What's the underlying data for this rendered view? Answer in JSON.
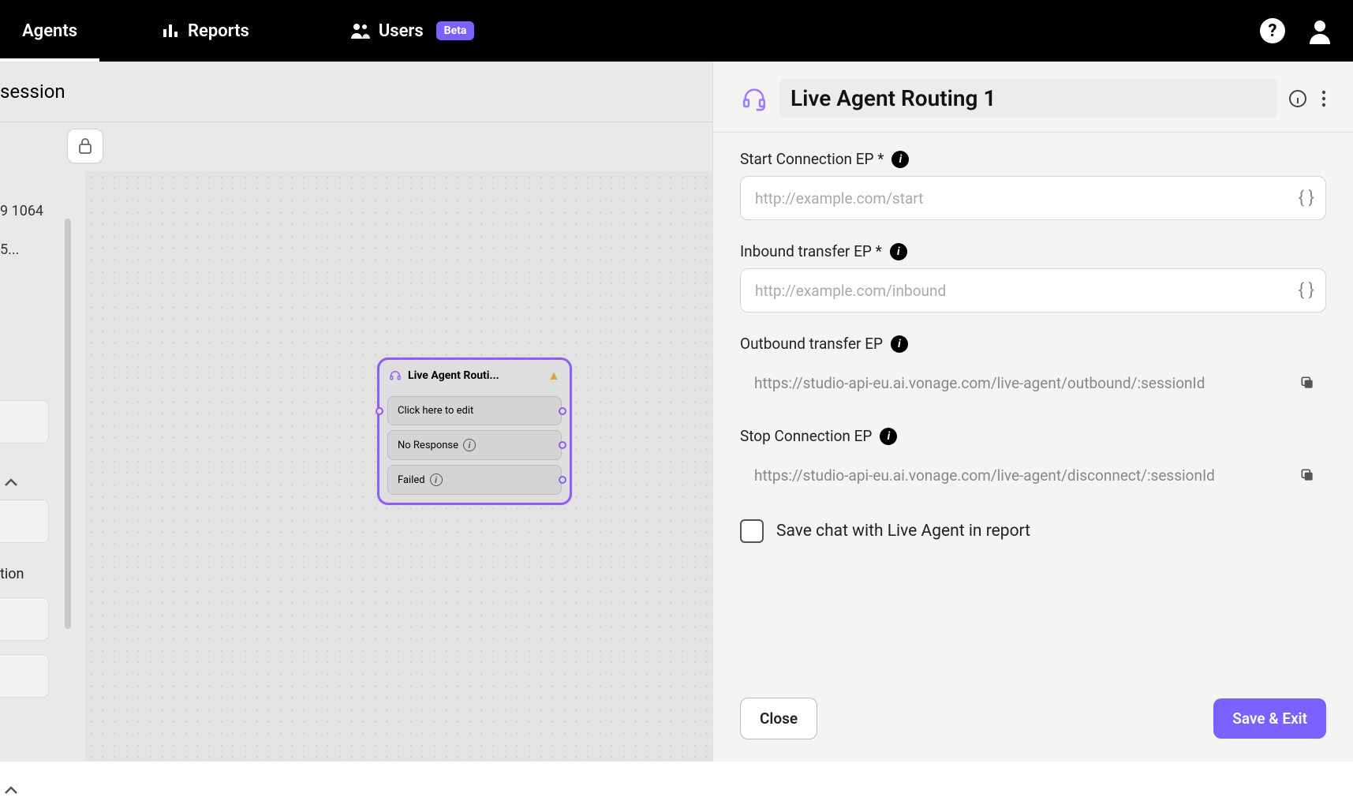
{
  "nav": {
    "items": [
      {
        "label": "Agents",
        "active": true
      },
      {
        "label": "Reports"
      },
      {
        "label": "Users",
        "badge": "Beta"
      }
    ]
  },
  "workspace": {
    "title": "session",
    "sidebar": {
      "line1": "9 1064",
      "line2": "5...",
      "row_label": "tion"
    }
  },
  "node": {
    "title": "Live Agent Routi...",
    "rows": [
      {
        "label": "Click here to edit"
      },
      {
        "label": "No Response",
        "info": true
      },
      {
        "label": "Failed",
        "info": true
      }
    ]
  },
  "panel": {
    "title": "Live Agent Routing 1",
    "fields": {
      "start": {
        "label": "Start Connection EP *",
        "placeholder": "http://example.com/start"
      },
      "inbound": {
        "label": "Inbound transfer EP *",
        "placeholder": "http://example.com/inbound"
      },
      "outbound": {
        "label": "Outbound transfer EP",
        "value": "https://studio-api-eu.ai.vonage.com/live-agent/outbound/:sessionId"
      },
      "stop": {
        "label": "Stop Connection EP",
        "value": "https://studio-api-eu.ai.vonage.com/live-agent/disconnect/:sessionId"
      }
    },
    "checkbox_label": "Save chat with Live Agent in report",
    "buttons": {
      "close": "Close",
      "save": "Save & Exit"
    }
  }
}
